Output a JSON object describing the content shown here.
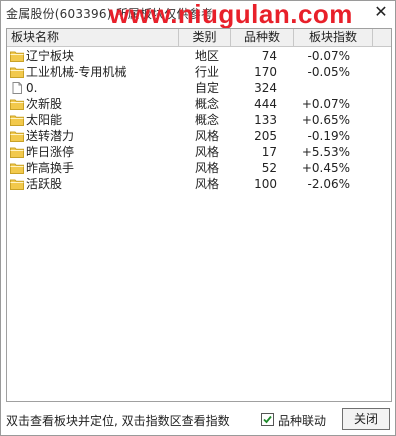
{
  "window": {
    "title": "金属股份(603396)  所属板块仅供参考",
    "watermark": "www.niugulan.com"
  },
  "table": {
    "headers": {
      "name": "板块名称",
      "type": "类别",
      "count": "品种数",
      "index": "板块指数"
    },
    "rows": [
      {
        "icon": "folder-icon",
        "name": "辽宁板块",
        "type": "地区",
        "count": "74",
        "index": "-0.07%"
      },
      {
        "icon": "folder-icon",
        "name": "工业机械-专用机械",
        "type": "行业",
        "count": "170",
        "index": "-0.05%"
      },
      {
        "icon": "document-icon",
        "name": "0.",
        "type": "自定",
        "count": "324",
        "index": ""
      },
      {
        "icon": "folder-icon",
        "name": "次新股",
        "type": "概念",
        "count": "444",
        "index": "+0.07%"
      },
      {
        "icon": "folder-icon",
        "name": "太阳能",
        "type": "概念",
        "count": "133",
        "index": "+0.65%"
      },
      {
        "icon": "folder-icon",
        "name": "送转潜力",
        "type": "风格",
        "count": "205",
        "index": "-0.19%"
      },
      {
        "icon": "folder-icon",
        "name": "昨日涨停",
        "type": "风格",
        "count": "17",
        "index": "+5.53%"
      },
      {
        "icon": "folder-icon",
        "name": "昨高换手",
        "type": "风格",
        "count": "52",
        "index": "+0.45%"
      },
      {
        "icon": "folder-icon",
        "name": "活跃股",
        "type": "风格",
        "count": "100",
        "index": "-2.06%"
      }
    ]
  },
  "status": {
    "hint": "双击查看板块并定位, 双击指数区查看指数",
    "checkbox_label": "品种联动",
    "checkbox_checked": true,
    "close_button": "关闭"
  },
  "colors": {
    "folder": "#f2c94c",
    "folder_dark": "#c9a227",
    "watermark": "#e8202a"
  }
}
